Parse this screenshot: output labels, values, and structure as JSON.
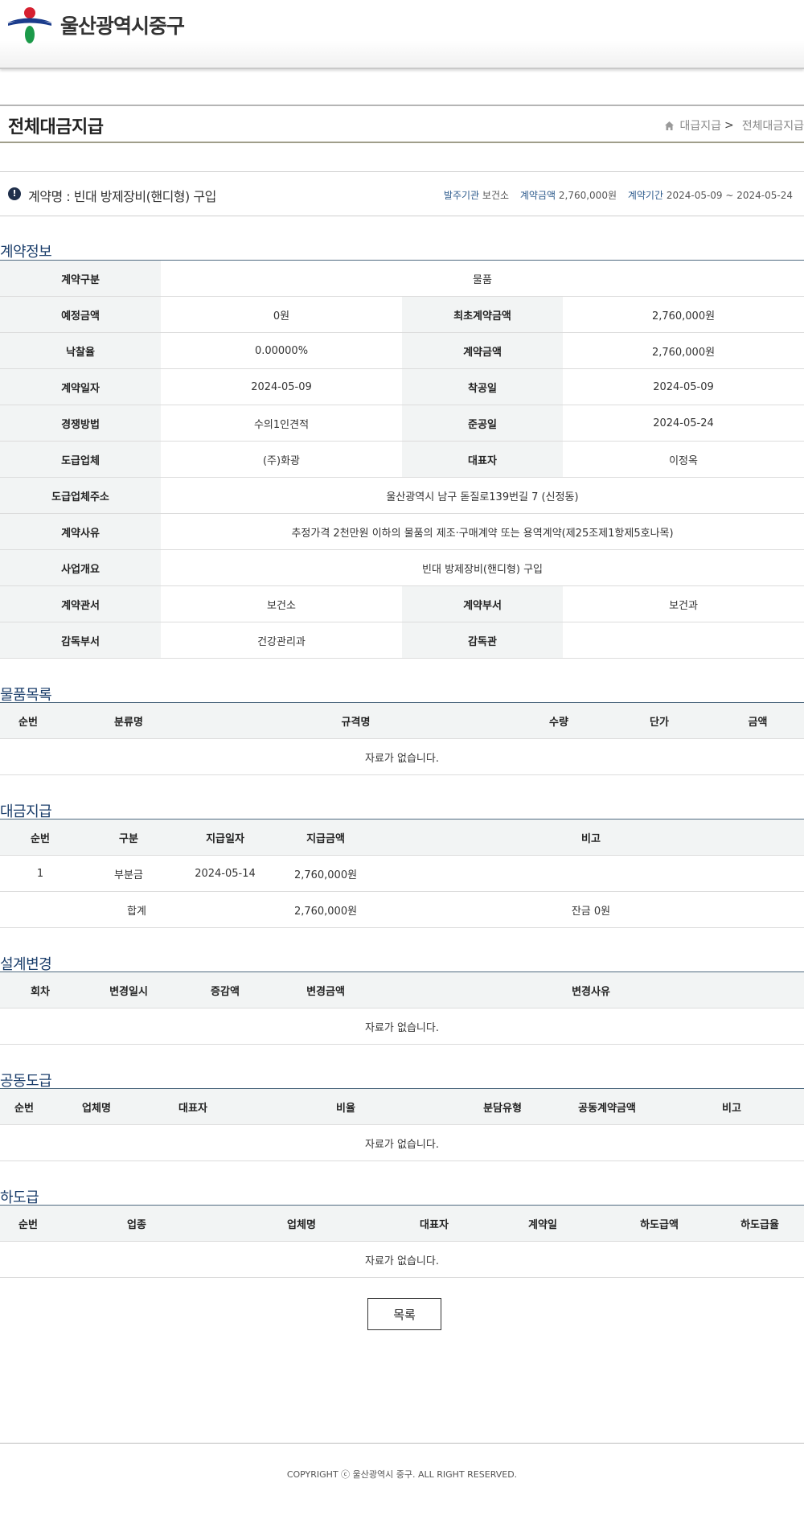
{
  "header": {
    "logo_text": "울산광역시중구"
  },
  "page": {
    "title": "전체대금지급",
    "breadcrumb": [
      "대급지급",
      "전체대금지급"
    ]
  },
  "summary": {
    "name_label": "계약명 : 빈대 방제장비(핸디형) 구입",
    "orderer_label": "발주기관",
    "orderer": "보건소",
    "amount_label": "계약금액",
    "amount": "2,760,000원",
    "period_label": "계약기간",
    "period": "2024-05-09 ~ 2024-05-24"
  },
  "contract_info": {
    "title": "계약정보",
    "rows": [
      {
        "l1": "계약구분",
        "v1": "물품"
      },
      {
        "l1": "예정금액",
        "v1": "0원",
        "l2": "최초계약금액",
        "v2": "2,760,000원"
      },
      {
        "l1": "낙찰율",
        "v1": "0.00000%",
        "l2": "계약금액",
        "v2": "2,760,000원"
      },
      {
        "l1": "계약일자",
        "v1": "2024-05-09",
        "l2": "착공일",
        "v2": "2024-05-09"
      },
      {
        "l1": "경쟁방법",
        "v1": "수의1인견적",
        "l2": "준공일",
        "v2": "2024-05-24"
      },
      {
        "l1": "도급업체",
        "v1": "(주)화광",
        "l2": "대표자",
        "v2": "이정옥"
      },
      {
        "l1": "도급업체주소",
        "v1": "울산광역시 남구 돋질로139번길 7 (신정동)"
      },
      {
        "l1": "계약사유",
        "v1": "추정가격 2천만원 이하의 물품의 제조·구매계약 또는 용역계약(제25조제1항제5호나목)"
      },
      {
        "l1": "사업개요",
        "v1": "빈대 방제장비(핸디형) 구입"
      },
      {
        "l1": "계약관서",
        "v1": "보건소",
        "l2": "계약부서",
        "v2": "보건과"
      },
      {
        "l1": "감독부서",
        "v1": "건강관리과",
        "l2": "감독관",
        "v2": ""
      }
    ]
  },
  "goods": {
    "title": "물품목록",
    "columns": [
      "순번",
      "분류명",
      "규격명",
      "수량",
      "단가",
      "금액"
    ],
    "empty": "자료가 없습니다."
  },
  "payments": {
    "title": "대금지급",
    "columns": [
      "순번",
      "구분",
      "지급일자",
      "지급금액",
      "비고"
    ],
    "rows": [
      {
        "no": "1",
        "type": "부분금",
        "date": "2024-05-14",
        "amount": "2,760,000원",
        "note": ""
      }
    ],
    "total_label": "합계",
    "total_amount": "2,760,000원",
    "balance": "잔금 0원"
  },
  "design_change": {
    "title": "설계변경",
    "columns": [
      "회차",
      "변경일시",
      "증감액",
      "변경금액",
      "변경사유"
    ],
    "empty": "자료가 없습니다."
  },
  "joint": {
    "title": "공동도급",
    "columns": [
      "순번",
      "업체명",
      "대표자",
      "비율",
      "분담유형",
      "공동계약금액",
      "비고"
    ],
    "empty": "자료가 없습니다."
  },
  "subcontract": {
    "title": "하도급",
    "columns": [
      "순번",
      "업종",
      "업체명",
      "대표자",
      "계약일",
      "하도급액",
      "하도급율"
    ],
    "empty": "자료가 없습니다."
  },
  "list_button": "목록",
  "footer": {
    "copyright": "COPYRIGHT ⓒ 울산광역시 중구. ALL RIGHT RESERVED."
  },
  "colors": {
    "accent": "#1b3e6b",
    "label_bg": "#f2f4f4"
  }
}
